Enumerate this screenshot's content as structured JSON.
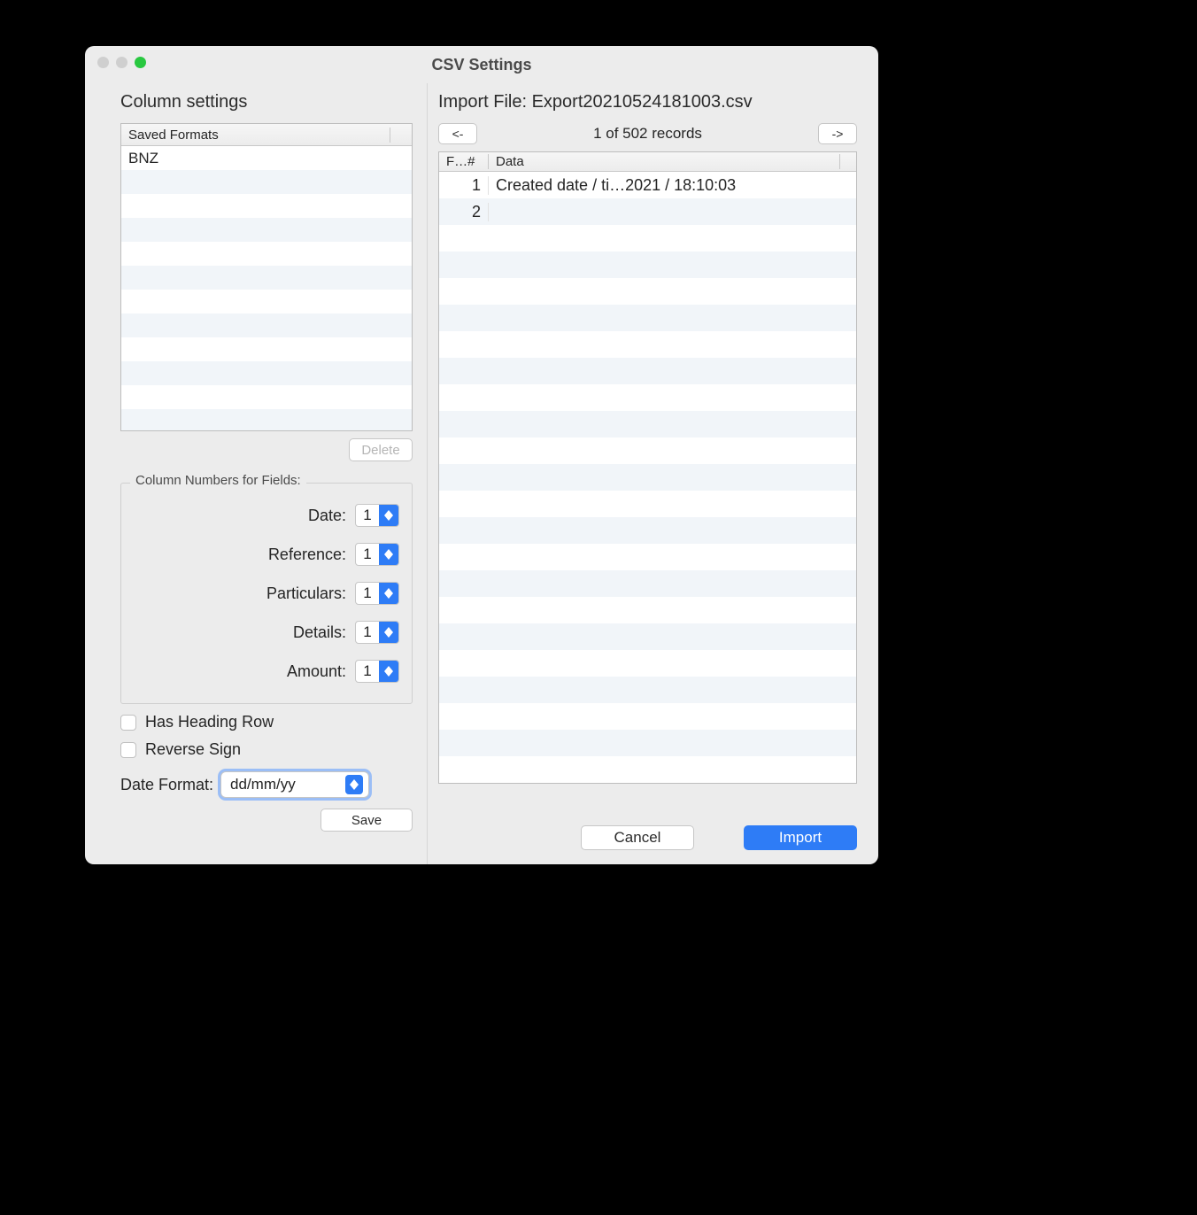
{
  "window": {
    "title": "CSV Settings"
  },
  "left": {
    "heading": "Column settings",
    "saved_formats_header": "Saved Formats",
    "saved_formats": [
      "BNZ"
    ],
    "delete_label": "Delete",
    "fieldset_legend": "Column Numbers for Fields:",
    "fields": {
      "date": {
        "label": "Date:",
        "value": "1"
      },
      "reference": {
        "label": "Reference:",
        "value": "1"
      },
      "particulars": {
        "label": "Particulars:",
        "value": "1"
      },
      "details": {
        "label": "Details:",
        "value": "1"
      },
      "amount": {
        "label": "Amount:",
        "value": "1"
      }
    },
    "has_heading_label": "Has Heading Row",
    "reverse_sign_label": "Reverse Sign",
    "date_format_label": "Date Format:",
    "date_format_value": "dd/mm/yy",
    "save_label": "Save"
  },
  "right": {
    "heading": "Import File: Export20210524181003.csv",
    "prev_label": "<-",
    "next_label": "->",
    "record_status": "1 of 502 records",
    "col_field": "F…#",
    "col_data": "Data",
    "rows": [
      {
        "n": "1",
        "data": "Created date / ti…2021 / 18:10:03"
      },
      {
        "n": "2",
        "data": ""
      }
    ],
    "cancel_label": "Cancel",
    "import_label": "Import"
  }
}
